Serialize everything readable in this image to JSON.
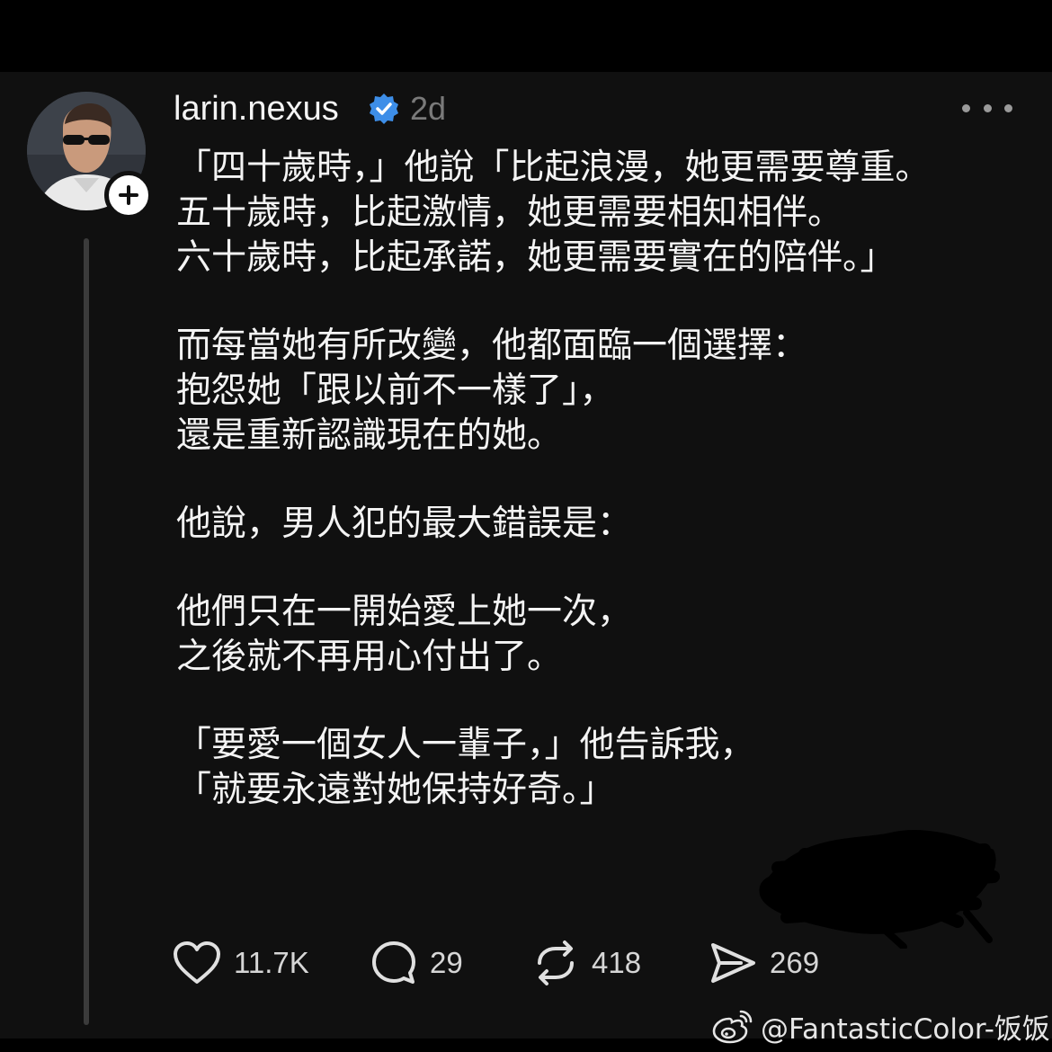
{
  "post": {
    "username": "larin.nexus",
    "timestamp": "2d",
    "lines": [
      "「四十歲時，」他說「比起浪漫，她更需要尊重。",
      "五十歲時，比起激情，她更需要相知相伴。",
      "六十歲時，比起承諾，她更需要實在的陪伴。」",
      "",
      "而每當她有所改變，他都面臨一個選擇：",
      "抱怨她「跟以前不一樣了」，",
      "還是重新認識現在的她。",
      "",
      "他說，男人犯的最大錯誤是：",
      "",
      "他們只在一開始愛上她一次，",
      "之後就不再用心付出了。",
      "",
      "「要愛一個女人一輩子，」他告訴我，",
      "「就要永遠對她保持好奇。」"
    ]
  },
  "actions": {
    "likes": "11.7K",
    "replies": "29",
    "reposts": "418",
    "shares": "269"
  },
  "watermark": {
    "text": "@FantasticColor-饭饭"
  },
  "icons": {
    "avatar": "avatar",
    "follow": "plus-icon",
    "verified": "verified-badge-icon",
    "more": "more-options-icon",
    "like": "heart-icon",
    "reply": "comment-icon",
    "repost": "repost-icon",
    "share": "send-icon",
    "watermark": "weibo-icon"
  },
  "colors": {
    "background": "#101010",
    "verified_badge": "#3d8ee8"
  }
}
